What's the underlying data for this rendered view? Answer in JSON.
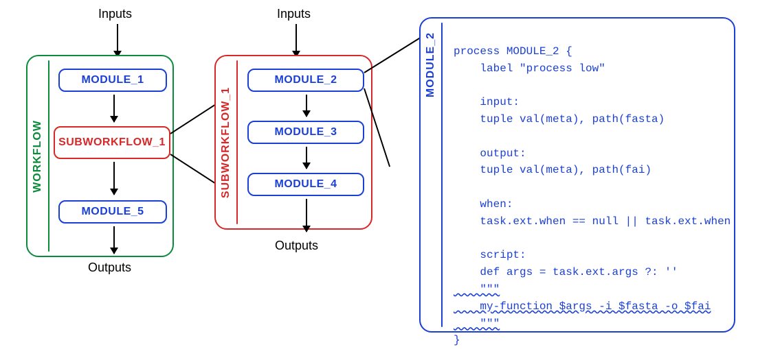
{
  "labels": {
    "inputs_left": "Inputs",
    "inputs_mid": "Inputs",
    "outputs_left": "Outputs",
    "outputs_mid": "Outputs"
  },
  "workflow": {
    "title": "WORKFLOW",
    "nodes": {
      "module_1": "MODULE_1",
      "subworkflow_1": "SUBWORKFLOW_1",
      "module_5": "MODULE_5"
    }
  },
  "subworkflow": {
    "title": "SUBWORKFLOW_1",
    "nodes": {
      "module_2": "MODULE_2",
      "module_3": "MODULE_3",
      "module_4": "MODULE_4"
    }
  },
  "module_panel": {
    "title": "MODULE_2",
    "code": {
      "l1": "process MODULE_2 {",
      "l2": "    label \"process low\"",
      "l3": "",
      "l4": "    input:",
      "l5": "    tuple val(meta), path(fasta)",
      "l6": "",
      "l7": "    output:",
      "l8": "    tuple val(meta), path(fai)",
      "l9": "",
      "l10": "    when:",
      "l11": "    task.ext.when == null || task.ext.when",
      "l12": "",
      "l13": "    script:",
      "l14": "    def args = task.ext.args ?: ''",
      "l15": "    \"\"\"",
      "l16": "    my-function $args -i $fasta -o $fai",
      "l17": "    \"\"\"",
      "l18": "}"
    }
  }
}
